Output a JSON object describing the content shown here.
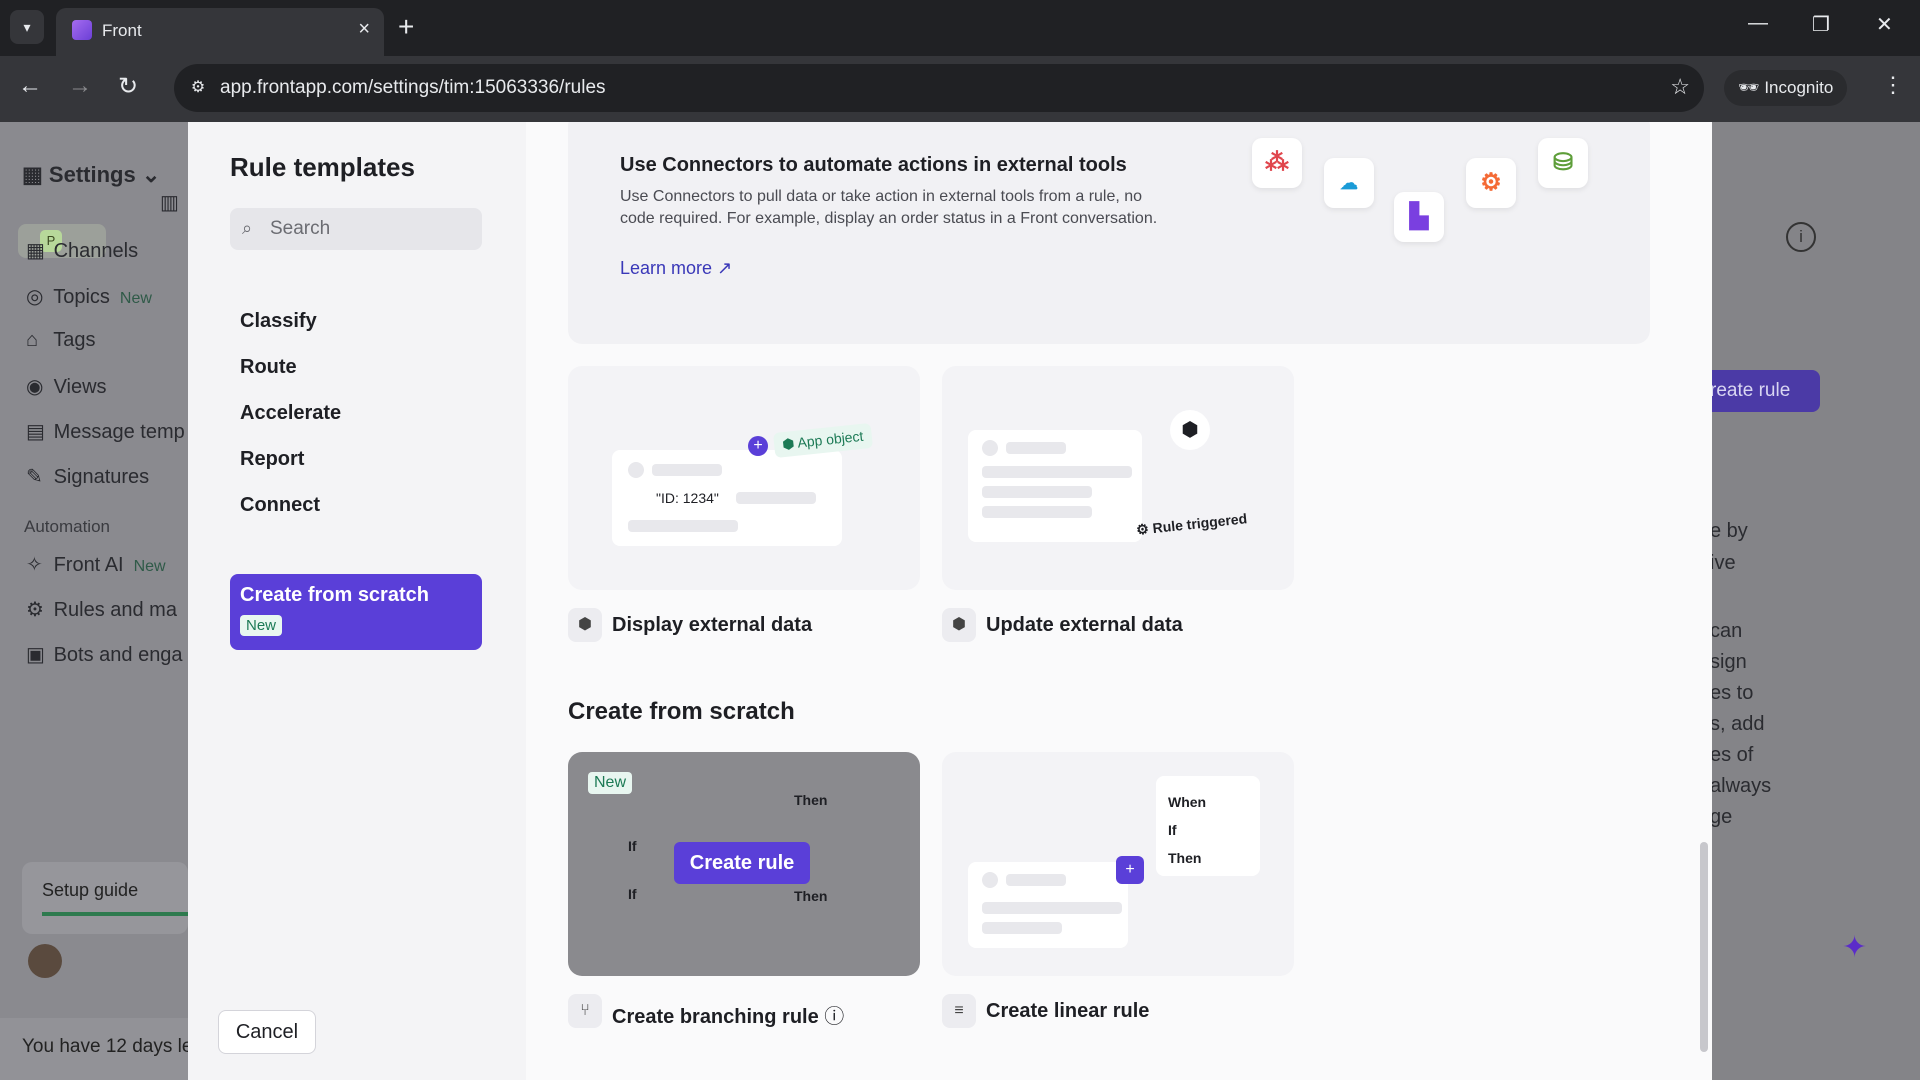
{
  "browser": {
    "tab_title": "Front",
    "url": "app.frontapp.com/settings/tim:15063336/rules",
    "incognito_label": "Incognito"
  },
  "app": {
    "sidebar_title": "Settings",
    "avatar_initial": "P",
    "items": [
      {
        "label": "Channels"
      },
      {
        "label": "Topics",
        "badge": "New"
      },
      {
        "label": "Tags"
      },
      {
        "label": "Views"
      },
      {
        "label": "Message temp"
      },
      {
        "label": "Signatures"
      }
    ],
    "automation_section": "Automation",
    "automation_items": [
      {
        "label": "Front AI",
        "badge": "New"
      },
      {
        "label": "Rules and ma"
      },
      {
        "label": "Bots and enga"
      }
    ],
    "setup_guide": "Setup guide",
    "trial_text": "You have 12 days le",
    "create_rule_label": "reate rule",
    "right_fragments": [
      "e by",
      "ive",
      "can",
      "sign",
      "es to",
      "s, add",
      "es of",
      "always",
      "ge"
    ]
  },
  "modal": {
    "title": "Rule templates",
    "search_placeholder": "Search",
    "categories": [
      "Classify",
      "Route",
      "Accelerate",
      "Report",
      "Connect"
    ],
    "active_category": "Create from scratch",
    "active_badge": "New",
    "cancel_label": "Cancel",
    "banner": {
      "title": "Use Connectors to automate actions in external tools",
      "description": "Use Connectors to pull data or take action in external tools from a rule, no code required. For example, display an order status in a Front conversation.",
      "learn_more": "Learn more"
    },
    "cards": [
      {
        "label": "Display external data",
        "pill": "App object",
        "id_text": "\"ID: 1234\""
      },
      {
        "label": "Update external data",
        "pill": "Rule triggered"
      }
    ],
    "section_title": "Create from scratch",
    "scratch_cards": [
      {
        "label": "Create branching rule",
        "badge": "New",
        "overlay_button": "Create rule",
        "flow": [
          "Then",
          "If",
          "If",
          "Then"
        ]
      },
      {
        "label": "Create linear rule",
        "flow": [
          "When",
          "If",
          "Then"
        ]
      }
    ]
  }
}
